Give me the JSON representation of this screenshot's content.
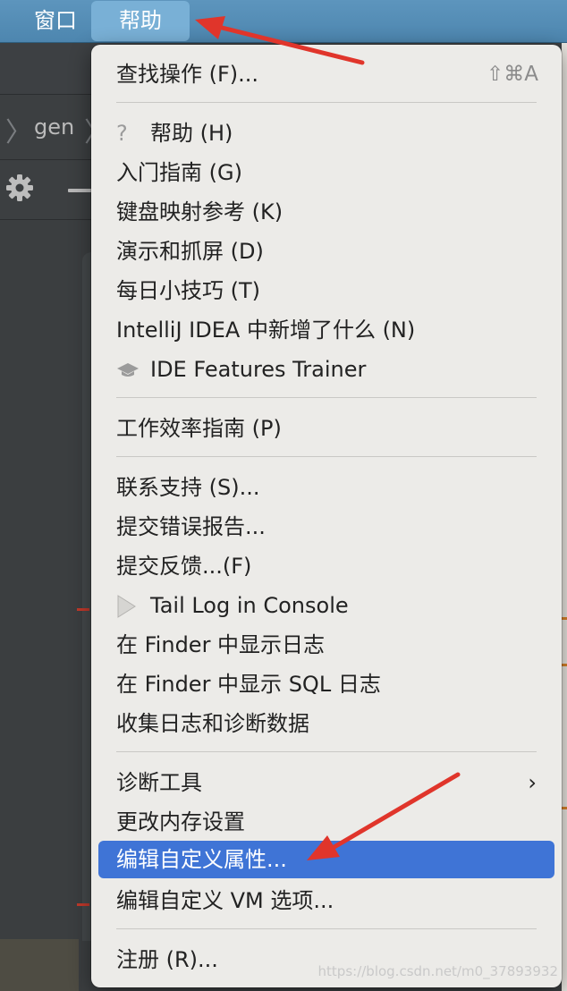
{
  "menubar": {
    "window_label": "窗口",
    "help_label": "帮助"
  },
  "background": {
    "breadcrumb_item": "gen"
  },
  "menu": {
    "items": [
      {
        "label": "查找操作 (F)...",
        "shortcut": "⇧⌘A"
      },
      {
        "label": "帮助 (H)",
        "icon": "question-icon",
        "icon_glyph": "?"
      },
      {
        "label": "入门指南 (G)"
      },
      {
        "label": "键盘映射参考 (K)"
      },
      {
        "label": "演示和抓屏 (D)"
      },
      {
        "label": "每日小技巧 (T)"
      },
      {
        "label": "IntelliJ IDEA 中新增了什么 (N)"
      },
      {
        "label": "IDE Features Trainer",
        "icon": "graduation-cap-icon"
      },
      {
        "label": "工作效率指南 (P)"
      },
      {
        "label": "联系支持 (S)..."
      },
      {
        "label": "提交错误报告..."
      },
      {
        "label": "提交反馈...(F)"
      },
      {
        "label": "Tail Log in Console",
        "icon": "play-icon"
      },
      {
        "label": "在 Finder 中显示日志"
      },
      {
        "label": "在 Finder 中显示 SQL 日志"
      },
      {
        "label": "收集日志和诊断数据"
      },
      {
        "label": "诊断工具",
        "submenu_glyph": "›"
      },
      {
        "label": "更改内存设置"
      },
      {
        "label": "编辑自定义属性...",
        "selected": true
      },
      {
        "label": "编辑自定义 VM 选项..."
      },
      {
        "label": "注册 (R)..."
      }
    ]
  },
  "watermark": "https://blog.csdn.net/m0_37893932",
  "colors": {
    "menubar": "#4d86af",
    "menubar_active": "#79b0d6",
    "menu_bg": "#ecebe8",
    "selection": "#3f74d6",
    "annotation_arrow": "#e0352b"
  }
}
